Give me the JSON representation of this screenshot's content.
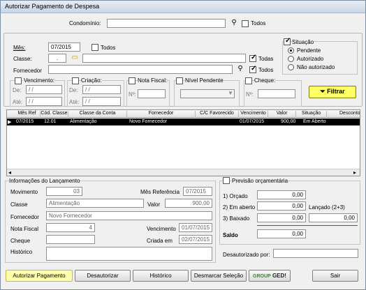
{
  "window": {
    "title": "Autorizar Pagamento de Despesa"
  },
  "top": {
    "condominio_label": "Condomínio:",
    "condominio_value": "",
    "todos_label": "Todos"
  },
  "filters": {
    "mes_label": "Mês:",
    "mes_value": "07/2015",
    "mes_todos": "Todos",
    "classe_label": "Classe:",
    "classe_code": ".",
    "classe_value": "",
    "classe_todas": "Todas",
    "fornecedor_label": "Fornecedor",
    "fornecedor_value": "",
    "fornecedor_todos": "Todos",
    "situacao_label": "Situação",
    "situacao_options": [
      "Pendente",
      "Autorizado",
      "Não autorizado"
    ],
    "vencimento_label": "Vencimento:",
    "criacao_label": "Criação:",
    "de_label": "De:",
    "ate_label": "Até:",
    "date_empty": "/ /",
    "nota_fiscal_label": "Nota Fiscal:",
    "nivel_pendente_label": "Nível Pendente",
    "cheque_label": "Cheque:",
    "no_label": "Nº:",
    "filtrar_label": "Filtrar"
  },
  "table": {
    "columns": [
      "Mês Ref",
      "Cód. Classe",
      "Classe da Conta",
      "Fornecedor",
      "C/C Favorecido",
      "Vencimento",
      "Valor",
      "Situação",
      "Desconto"
    ],
    "rows": [
      {
        "mes_ref": "07/2015",
        "cod_classe": "12.01",
        "classe_conta": "Alimentação",
        "fornecedor": "Novo Fornecedor",
        "cc_favorecido": "",
        "vencimento": "01/07/2015",
        "valor": "900,00",
        "situacao": "Em Aberto",
        "desconto": ""
      }
    ]
  },
  "lancamento": {
    "title": "Informações do Lançamento",
    "movimento_label": "Movimento",
    "movimento_value": "03",
    "mes_ref_label": "Mês Referência",
    "mes_ref_value": "07/2015",
    "classe_label": "Classe",
    "classe_value": "Alimentação",
    "valor_label": "Valor",
    "valor_value": "900,00",
    "fornecedor_label": "Fornecedor",
    "fornecedor_value": "Novo Fornecedor",
    "nota_fiscal_label": "Nota Fiscal",
    "nota_fiscal_value": "4",
    "vencimento_label": "Vencimento",
    "vencimento_value": "01/07/2015",
    "cheque_label": "Cheque",
    "cheque_value": "",
    "criada_label": "Criada em",
    "criada_value": "02/07/2015",
    "historico_label": "Histórico",
    "historico_value": ""
  },
  "previsao": {
    "title": "Previsão orçamentária",
    "orcado_label": "1) Orçado",
    "orcado_value": "0,00",
    "aberto_label": "2) Em aberto",
    "aberto_value": "0,00",
    "baixado_label": "3) Baixado",
    "baixado_value": "0,00",
    "lancado_label": "Lançado (2+3)",
    "lancado_value": "0,00",
    "saldo_label": "Saldo",
    "saldo_value": "0,00",
    "desautorizado_label": "Desautorizado por:",
    "desautorizado_value": ""
  },
  "buttons": {
    "autorizar": "Autorizar Pagamento",
    "desautorizar": "Desautorizar",
    "historico": "Histórico",
    "desmarcar": "Desmarcar Seleção",
    "group": "GROUP",
    "ged": "GED!",
    "sair": "Sair"
  },
  "colors": {
    "filtrar_bg": "#ffff66",
    "autorizar_bg": "#ffffb0",
    "selected_row": "#000000",
    "ged_green": "#2e8b2e"
  }
}
